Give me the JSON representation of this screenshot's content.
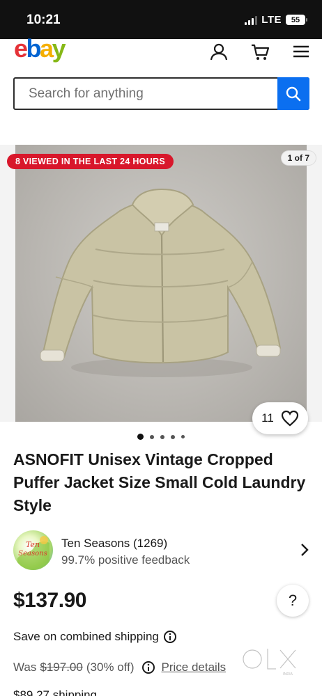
{
  "status_bar": {
    "time": "10:21",
    "network": "LTE",
    "battery": "55"
  },
  "header": {
    "logo": {
      "e": "e",
      "b": "b",
      "a": "a",
      "y": "y"
    },
    "icons": [
      "user-icon",
      "cart-icon",
      "menu-icon"
    ]
  },
  "search": {
    "placeholder": "Search for anything",
    "icon": "search-icon"
  },
  "gallery": {
    "badge": "8 VIEWED IN THE LAST 24 HOURS",
    "counter": "1 of 7",
    "watch_count": "11",
    "total_images": 7,
    "current_image": 1
  },
  "listing": {
    "title": "ASNOFIT Unisex Vintage Cropped Puffer Jacket Size Small Cold Laundry Style",
    "price": "$137.90",
    "combined_shipping": "Save on combined shipping",
    "was_label": "Was",
    "was_price": "$197.00",
    "discount": "(30% off)",
    "price_details": "Price details",
    "shipping": "$89.27 shipping"
  },
  "seller": {
    "name": "Ten Seasons (1269)",
    "feedback": "99.7% positive feedback",
    "avatar_text": "Ten Seasons"
  },
  "help": {
    "label": "?"
  },
  "watermark": {
    "text": "OLX",
    "sub": "INDIA"
  },
  "colors": {
    "brand_red": "#e53238",
    "brand_blue": "#0064d2",
    "brand_yellow": "#f5af02",
    "brand_green": "#86b817",
    "badge_red": "#d8172b",
    "search_blue": "#0b6ff0"
  }
}
